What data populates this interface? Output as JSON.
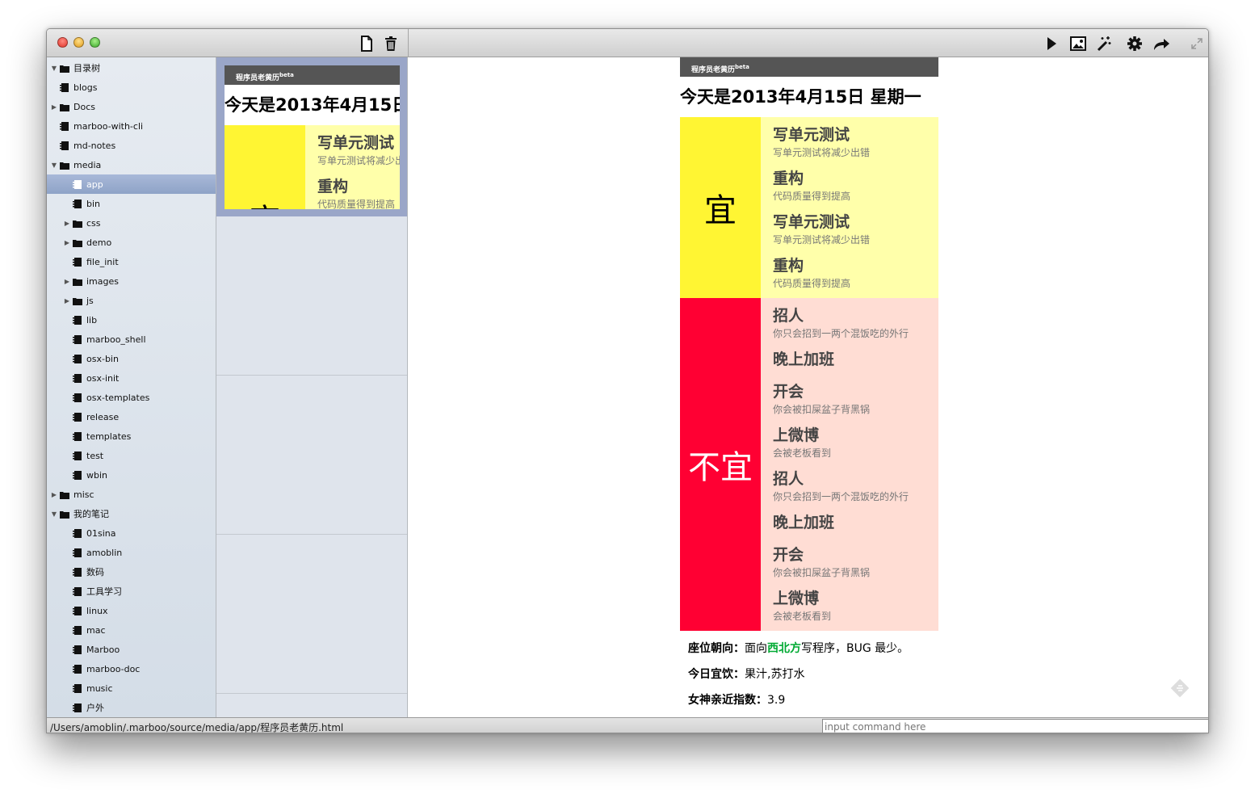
{
  "window": {
    "path": "/Users/amoblin/.marboo/source/media/app/程序员老黄历.html",
    "command_placeholder": "input command here"
  },
  "toolbar": {
    "left_icons": [
      "new-file-icon",
      "trash-icon"
    ],
    "right_icons": [
      "play-icon",
      "image-icon",
      "magic-wand-icon",
      "gear-icon",
      "share-arrow-icon",
      "fullscreen-icon"
    ]
  },
  "tree": [
    {
      "label": "目录树",
      "type": "folder",
      "open": true,
      "depth": 0
    },
    {
      "label": "blogs",
      "type": "doc",
      "depth": 0
    },
    {
      "label": "Docs",
      "type": "folder",
      "open": false,
      "depth": 0
    },
    {
      "label": "marboo-with-cli",
      "type": "doc",
      "depth": 0
    },
    {
      "label": "md-notes",
      "type": "doc",
      "depth": 0
    },
    {
      "label": "media",
      "type": "folder",
      "open": true,
      "depth": 0
    },
    {
      "label": "app",
      "type": "doc",
      "depth": 1,
      "selected": true
    },
    {
      "label": "bin",
      "type": "doc",
      "depth": 1
    },
    {
      "label": "css",
      "type": "folder",
      "open": false,
      "depth": 1
    },
    {
      "label": "demo",
      "type": "folder",
      "open": false,
      "depth": 1
    },
    {
      "label": "file_init",
      "type": "doc",
      "depth": 1
    },
    {
      "label": "images",
      "type": "folder",
      "open": false,
      "depth": 1
    },
    {
      "label": "js",
      "type": "folder",
      "open": false,
      "depth": 1
    },
    {
      "label": "lib",
      "type": "doc",
      "depth": 1
    },
    {
      "label": "marboo_shell",
      "type": "doc",
      "depth": 1
    },
    {
      "label": "osx-bin",
      "type": "doc",
      "depth": 1
    },
    {
      "label": "osx-init",
      "type": "doc",
      "depth": 1
    },
    {
      "label": "osx-templates",
      "type": "doc",
      "depth": 1
    },
    {
      "label": "release",
      "type": "doc",
      "depth": 1
    },
    {
      "label": "templates",
      "type": "doc",
      "depth": 1
    },
    {
      "label": "test",
      "type": "doc",
      "depth": 1
    },
    {
      "label": "wbin",
      "type": "doc",
      "depth": 1
    },
    {
      "label": "misc",
      "type": "folder",
      "open": false,
      "depth": 0
    },
    {
      "label": "我的笔记",
      "type": "folder",
      "open": true,
      "depth": 0
    },
    {
      "label": "01sina",
      "type": "doc",
      "depth": 1
    },
    {
      "label": "amoblin",
      "type": "doc",
      "depth": 1
    },
    {
      "label": "数码",
      "type": "doc",
      "depth": 1
    },
    {
      "label": "工具学习",
      "type": "doc",
      "depth": 1
    },
    {
      "label": "linux",
      "type": "doc",
      "depth": 1
    },
    {
      "label": "mac",
      "type": "doc",
      "depth": 1
    },
    {
      "label": "Marboo",
      "type": "doc",
      "depth": 1
    },
    {
      "label": "marboo-doc",
      "type": "doc",
      "depth": 1
    },
    {
      "label": "music",
      "type": "doc",
      "depth": 1
    },
    {
      "label": "户外",
      "type": "doc",
      "depth": 1
    }
  ],
  "thumbnail": {
    "date_truncated": "今天是2013年4月15日",
    "good_label_partial": "宜",
    "items": [
      {
        "title": "写单元测试",
        "desc": "写单元测试将减少出错"
      },
      {
        "title": "重构",
        "desc": "代码质量得到提高"
      }
    ]
  },
  "page": {
    "header": "程序员老黄历",
    "header_sup": "beta",
    "date": "今天是2013年4月15日  星期一",
    "good_label": "宜",
    "good_items": [
      {
        "title": "写单元测试",
        "desc": "写单元测试将减少出错"
      },
      {
        "title": "重构",
        "desc": "代码质量得到提高"
      },
      {
        "title": "写单元测试",
        "desc": "写单元测试将减少出错"
      },
      {
        "title": "重构",
        "desc": "代码质量得到提高"
      }
    ],
    "bad_label": "不宜",
    "bad_items": [
      {
        "title": "招人",
        "desc": "你只会招到一两个混饭吃的外行"
      },
      {
        "title": "晚上加班",
        "desc": ""
      },
      {
        "title": "开会",
        "desc": "你会被扣屎盆子背黑锅"
      },
      {
        "title": "上微博",
        "desc": "会被老板看到"
      },
      {
        "title": "招人",
        "desc": "你只会招到一两个混饭吃的外行"
      },
      {
        "title": "晚上加班",
        "desc": ""
      },
      {
        "title": "开会",
        "desc": "你会被扣屎盆子背黑锅"
      },
      {
        "title": "上微博",
        "desc": "会被老板看到"
      }
    ],
    "seat_label": "座位朝向：",
    "seat_prefix": "面向",
    "seat_dir": "西北方",
    "seat_suffix": "写程序，BUG 最少。",
    "drink_label": "今日宜饮：",
    "drink_value": "果汁,苏打水",
    "goddess_label": "女神亲近指数：",
    "goddess_value": "3.9"
  }
}
